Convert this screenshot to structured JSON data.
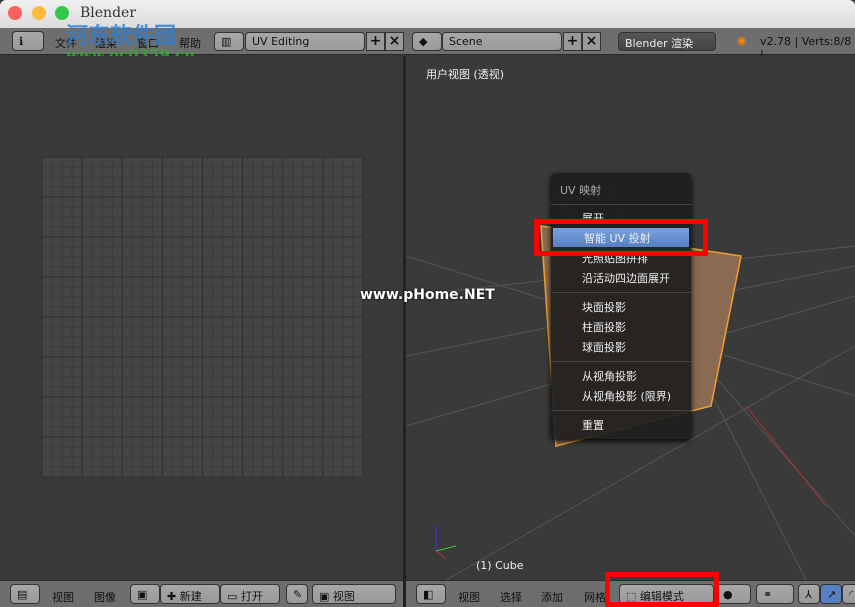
{
  "window": {
    "title": "Blender"
  },
  "watermark": {
    "logo_text": "河东软件园",
    "url": "www.pc0359.cn",
    "overlay": "www.pHome.NET"
  },
  "topbar": {
    "menus": [
      "文件",
      "渲染",
      "窗口",
      "帮助"
    ],
    "layout": "UV Editing",
    "scene": "Scene",
    "engine": "Blender 渲染",
    "version": "v2.78 | Verts:8/8 |"
  },
  "viewport": {
    "label": "用户视图 (透视)",
    "object": "(1) Cube"
  },
  "uv_menu": {
    "title": "UV 映射",
    "items": [
      "展开",
      "智能 UV 投射",
      "光照贴图拼排",
      "沿活动四边面展开",
      "块面投影",
      "柱面投影",
      "球面投影",
      "从视角投影",
      "从视角投影 (限界)",
      "重置"
    ],
    "highlighted": "智能 UV 投射"
  },
  "uv_header": {
    "menus": [
      "视图",
      "图像"
    ],
    "new": "新建",
    "open": "打开",
    "view": "视图"
  },
  "v3d_header": {
    "menus": [
      "视图",
      "选择",
      "添加",
      "网格"
    ],
    "mode": "编辑模式"
  },
  "colors": {
    "accent": "#5680c2",
    "highlight_box": "#ff0000",
    "mesh": "#f0a030"
  }
}
